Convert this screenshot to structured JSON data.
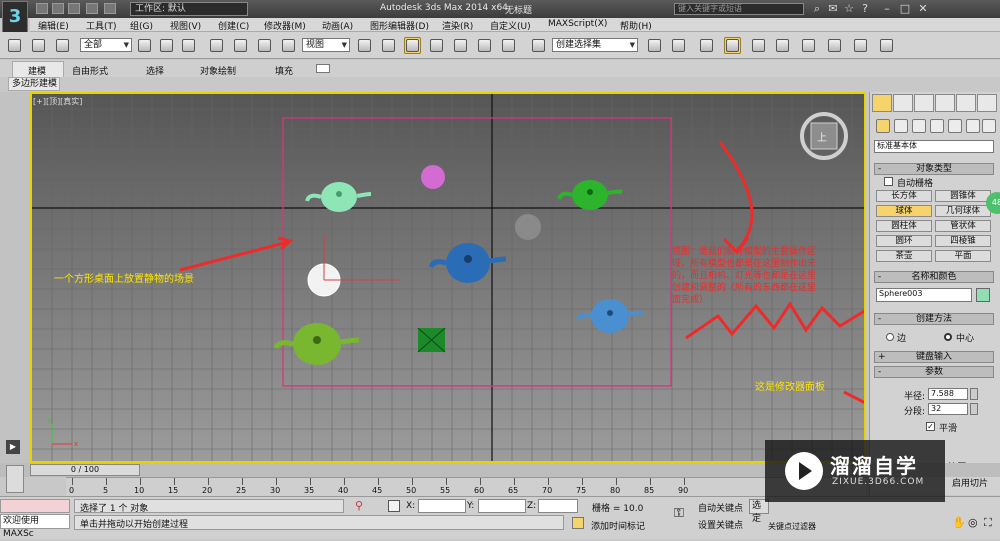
{
  "titlebar": {
    "logo_text": "3",
    "workspace_label": "工作区: 默认",
    "app_title": "Autodesk 3ds Max  2014 x64",
    "doc_title": "无标题",
    "search_placeholder": "键入关键字或短语"
  },
  "menu": [
    "编辑(E)",
    "工具(T)",
    "组(G)",
    "视图(V)",
    "创建(C)",
    "修改器(M)",
    "动画(A)",
    "图形编辑器(D)",
    "渲染(R)",
    "自定义(U)",
    "MAXScript(X)",
    "帮助(H)"
  ],
  "toolbar": {
    "filter_select": "全部",
    "ref_coord_select": "视图",
    "named_selection": "创建选择集"
  },
  "ribbon": {
    "tabs": [
      "建模",
      "自由形式",
      "选择",
      "对象绘制",
      "填充"
    ],
    "active_tab": "建模",
    "subtab": "多边形建模"
  },
  "viewport": {
    "label": "[+][顶][真实]",
    "annotation_left": "一个方形桌面上放置静物的场景",
    "annotation_right": "视图：是我们制作模型的主要操作区域，所有模型也都是在这里制作出来的，而且相机、灯光等也都是在这里创建和调整的（所有的东西都在这里面完成）",
    "annotation_panel": "这是修改器面板",
    "view_cube_label": "上"
  },
  "command_panel": {
    "category_select": "标准基本体",
    "rollout_object_type": "对象类型",
    "autogrid_label": "自动栅格",
    "object_buttons": [
      "长方体",
      "圆锥体",
      "球体",
      "几何球体",
      "圆柱体",
      "管状体",
      "圆环",
      "四棱锥",
      "茶壶",
      "平面"
    ],
    "active_object": "球体",
    "rollout_name_color": "名称和颜色",
    "object_name": "Sphere003",
    "rollout_creation_method": "创建方法",
    "method_edge": "边",
    "method_center": "中心",
    "rollout_keyboard": "键盘输入",
    "rollout_params": "参数",
    "radius_label": "半径:",
    "radius_value": "7.588",
    "segments_label": "分段:",
    "segments_value": "32",
    "smooth_label": "平滑",
    "partial_labels": [
      "挤压",
      "启用切片"
    ],
    "badge": "48"
  },
  "timeline": {
    "slider_label": "0 / 100",
    "ruler_ticks": [
      "0",
      "5",
      "10",
      "15",
      "20",
      "25",
      "30",
      "35",
      "40",
      "45",
      "50",
      "55",
      "60",
      "65",
      "70",
      "75",
      "80",
      "85",
      "90"
    ]
  },
  "status": {
    "welcome": "欢迎使用 MAXSc",
    "selected": "选择了 1 个 对象",
    "hint": "单击并拖动以开始创建过程",
    "x_label": "X:",
    "y_label": "Y:",
    "z_label": "Z:",
    "grid": "栅格 = 10.0",
    "add_time_tag": "添加时间标记",
    "auto_key": "自动关键点",
    "set_key": "设置关键点",
    "select_box": "选定",
    "filter_partial": "关键点过滤器"
  },
  "watermark": {
    "title": "溜溜自学",
    "url": "ZIXUE.3D66.COM"
  },
  "colors": {
    "viewport_border": "#e6d400",
    "annotation_red": "#ee2b2b",
    "annotation_yellow": "#ffe600",
    "active_button": "#f6d36b"
  }
}
